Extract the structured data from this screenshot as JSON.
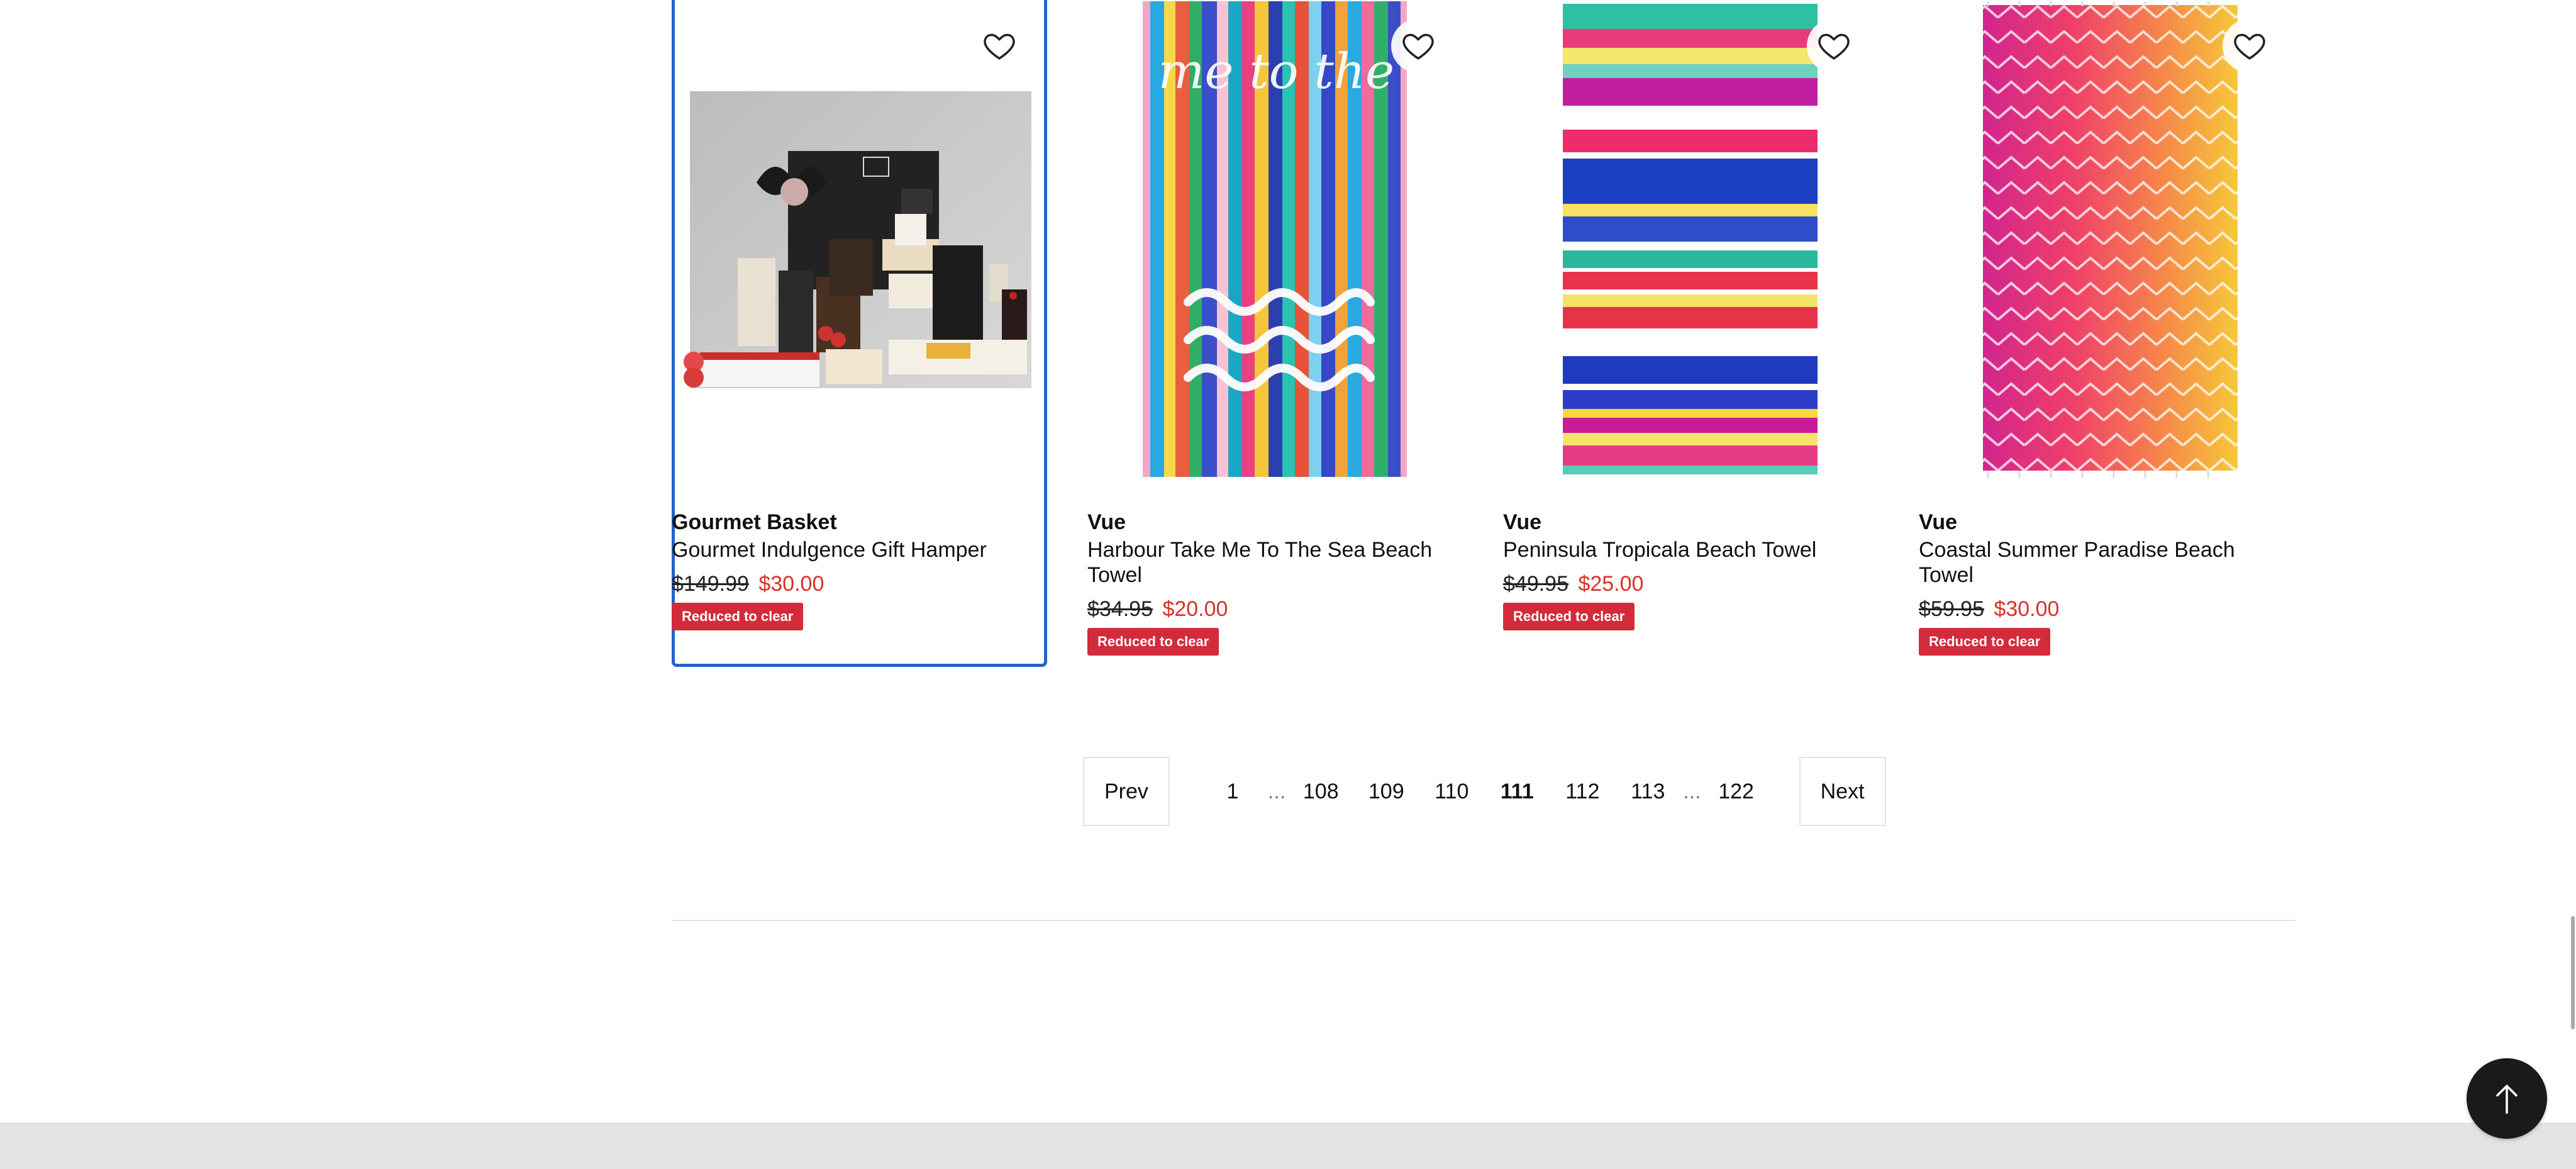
{
  "products": [
    {
      "brand": "Gourmet Basket",
      "name": "Gourmet Indulgence Gift Hamper",
      "was_price": "$149.99",
      "now_price": "$30.00",
      "badge": "Reduced to clear",
      "image_icon": "gift-hamper-image",
      "focused": true
    },
    {
      "brand": "Vue",
      "name": "Harbour Take Me To The Sea Beach Towel",
      "was_price": "$34.95",
      "now_price": "$20.00",
      "badge": "Reduced to clear",
      "image_icon": "striped-towel-image",
      "image_text": "take me to the SEA"
    },
    {
      "brand": "Vue",
      "name": "Peninsula Tropicala Beach Towel",
      "was_price": "$49.95",
      "now_price": "$25.00",
      "badge": "Reduced to clear",
      "image_icon": "horizontal-stripe-towel-image"
    },
    {
      "brand": "Vue",
      "name": "Coastal Summer Paradise Beach Towel",
      "was_price": "$59.95",
      "now_price": "$30.00",
      "badge": "Reduced to clear",
      "image_icon": "chevron-towel-image"
    }
  ],
  "pagination": {
    "prev_label": "Prev",
    "next_label": "Next",
    "ellipsis": "...",
    "pages": [
      "1",
      "108",
      "109",
      "110",
      "111",
      "112",
      "113",
      "122"
    ],
    "current": "111"
  },
  "colors": {
    "sale_price": "#d8322a",
    "badge_bg": "#d42b3a",
    "focus_border": "#2563c9"
  }
}
